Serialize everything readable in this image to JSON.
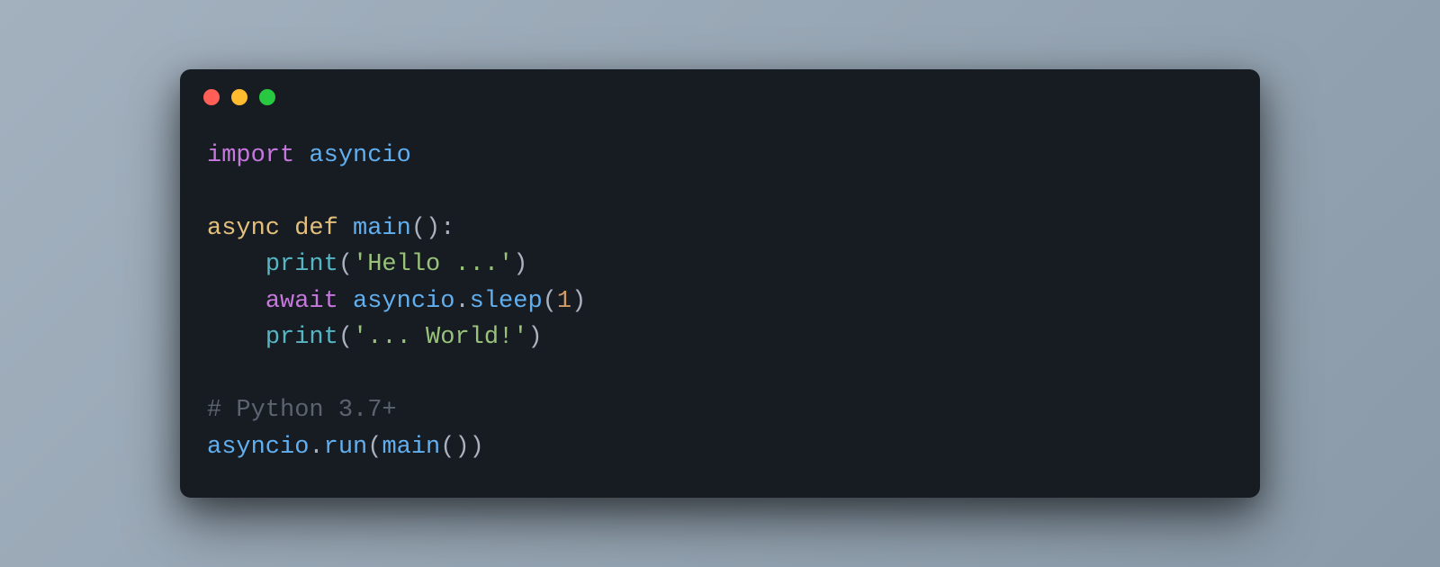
{
  "colors": {
    "red": "#ff5f57",
    "yellow": "#febc2e",
    "green": "#28c840",
    "bg": "#171c23"
  },
  "code": {
    "line1": {
      "import_kw": "import",
      "module": "asyncio"
    },
    "line3": {
      "async_kw": "async",
      "def_kw": "def",
      "fname": "main",
      "parens": "():"
    },
    "line4": {
      "indent": "    ",
      "print_fn": "print",
      "open": "(",
      "str": "'Hello ...'",
      "close": ")"
    },
    "line5": {
      "indent": "    ",
      "await_kw": "await",
      "module": "asyncio",
      "dot": ".",
      "method": "sleep",
      "open": "(",
      "arg": "1",
      "close": ")"
    },
    "line6": {
      "indent": "    ",
      "print_fn": "print",
      "open": "(",
      "str": "'... World!'",
      "close": ")"
    },
    "line8": {
      "comment": "# Python 3.7+"
    },
    "line9": {
      "module": "asyncio",
      "dot": ".",
      "method": "run",
      "open": "(",
      "arg": "main",
      "argparens": "()",
      "close": ")"
    }
  }
}
